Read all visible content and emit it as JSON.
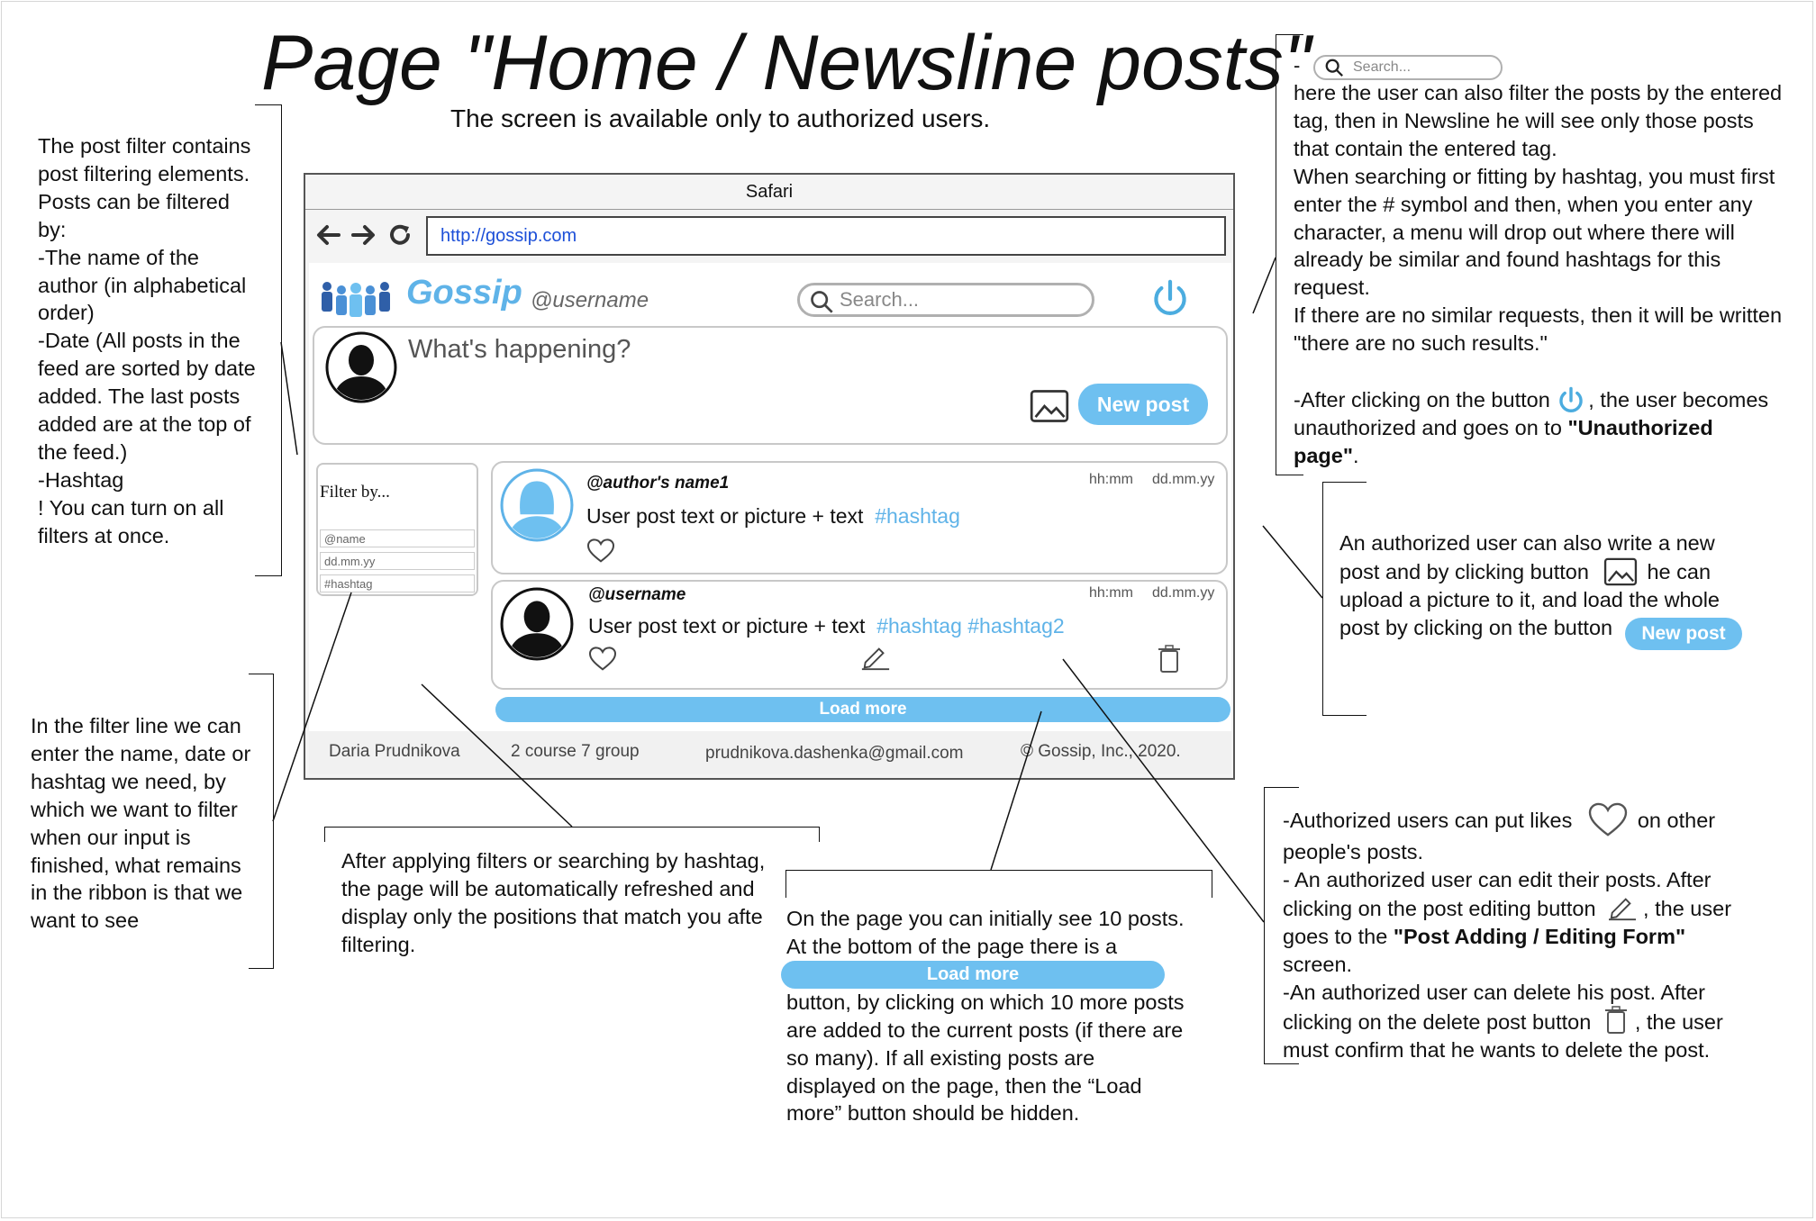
{
  "title": "Page \"Home / Newsline posts\"",
  "subtitle": "The screen is available only to authorized users.",
  "browser": {
    "name": "Safari",
    "url": "http://gossip.com"
  },
  "header": {
    "logo_text": "Gossip",
    "username": "@username",
    "search_placeholder": "Search..."
  },
  "composer": {
    "placeholder": "What's happening?",
    "new_post_label": "New post"
  },
  "filter": {
    "title": "Filter by...",
    "fields": [
      "@name",
      "dd.mm.yy",
      "#hashtag"
    ]
  },
  "posts": [
    {
      "author": "@author's name1",
      "time": "hh:mm",
      "date": "dd.mm.yy",
      "text": "User post text or picture + text",
      "tags": "#hashtag"
    },
    {
      "author": "@username",
      "time": "hh:mm",
      "date": "dd.mm.yy",
      "text": "User post text or picture + text",
      "tags": "#hashtag #hashtag2"
    }
  ],
  "load_more_label": "Load more",
  "footer": {
    "name": "Daria Prudnikova",
    "group": "2 course 7 group",
    "email": "prudnikova.dashenka@gmail.com",
    "copyright": "© Gossip, Inc., 2020."
  },
  "notes": {
    "filter_left": [
      "The post filter contains",
      "post filtering elements.",
      "Posts can be filtered",
      "by:",
      "-The name of the",
      "author (in alphabetical",
      "order)",
      "-Date (All posts in the",
      "feed are sorted by date",
      "added. The last posts",
      "added are at the top of",
      "the feed.)",
      "-Hashtag",
      "! You can turn on all",
      "filters at once."
    ],
    "filter_line": [
      "In the filter line we can",
      "enter the name, date or",
      "hashtag we need, by",
      "which we want to filter",
      "when our input is",
      "finished, what remains",
      "in the ribbon is that we",
      "want to see"
    ],
    "after_filters": [
      "After applying filters or searching by hashtag,",
      "the page will be automatically refreshed and",
      "display only the positions that match you afte",
      "filtering."
    ],
    "load_more_top": [
      "On the page you can initially see 10 posts.",
      "At the bottom of the page there is a"
    ],
    "load_more_bottom": [
      "button, by clicking on which 10 more posts",
      "are added to the current posts (if there are",
      "so many). If all existing posts are",
      "displayed on the page, then the “Load",
      "more” button should be hidden."
    ],
    "search_dash": "-",
    "search_placeholder": "Search...",
    "search_lines": [
      "here the user can also filter the posts by the entered",
      "tag, then in Newsline he will see only those posts",
      "that contain the entered tag.",
      "When searching or fitting by hashtag, you must first",
      "enter the # symbol and then, when you enter any",
      "character, a menu will drop out where there will",
      "already be similar and found hashtags for this",
      "request.",
      "If there are no similar requests, then it will be written",
      "\"there are no such results.\""
    ],
    "logout_pre": "-After clicking on the button",
    "logout_post": ", the user becomes",
    "logout_line2_pre": "unauthorized and goes on to ",
    "logout_line2_bold": "\"Unauthorized",
    "logout_line3_bold": "page\"",
    "logout_line3_post": ".",
    "newpost_line1": "An authorized user can also write a new",
    "newpost_line2_pre": "post and by clicking button",
    "newpost_line2_post": "he can",
    "newpost_line3": "upload a picture to it, and load the whole",
    "newpost_line4": "post by clicking on the button",
    "newpost_button": "New post",
    "likes_pre": "-Authorized users can put likes",
    "likes_post": "on other",
    "likes_line2": "people's posts.",
    "edit_line1": "- An authorized user can edit their posts. After",
    "edit_line2_pre": "clicking on the post editing button",
    "edit_line2_post": ", the user",
    "edit_line3_pre": "goes to the ",
    "edit_line3_bold": "\"Post Adding / Editing Form\"",
    "edit_line4": "screen.",
    "delete_line1": "-An authorized user can delete his post. After",
    "delete_line2_pre": "clicking on the delete post button",
    "delete_line2_post": ", the user",
    "delete_line3": "must confirm that he wants to delete the post."
  },
  "icons": {
    "back": "arrow-left-icon",
    "forward": "arrow-right-icon",
    "reload": "reload-icon",
    "power": "power-icon",
    "image": "image-icon",
    "like": "heart-icon",
    "edit": "pencil-icon",
    "delete": "trash-icon"
  },
  "colors": {
    "accent": "#5fb3e8",
    "button": "#6ec0f0"
  }
}
